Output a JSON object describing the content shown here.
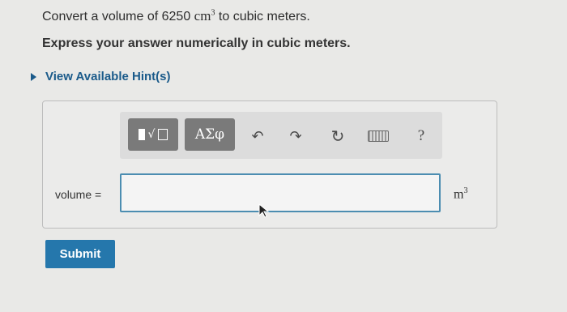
{
  "question": {
    "prefix": "Convert a volume of 6250",
    "unit": "cm",
    "unit_exponent": "3",
    "suffix": "to cubic meters.",
    "instruction": "Express your answer numerically in cubic meters."
  },
  "hints": {
    "label": "View Available Hint(s)"
  },
  "toolbar": {
    "greek_label": "ΑΣφ",
    "help_label": "?"
  },
  "answer": {
    "label": "volume =",
    "value": "",
    "placeholder": "",
    "unit": "m",
    "unit_exponent": "3"
  },
  "submit_label": "Submit",
  "colors": {
    "accent": "#2577ac",
    "link": "#1a5a8a",
    "input_border": "#4c8db1",
    "toolbar_button": "#7a7a7a"
  }
}
